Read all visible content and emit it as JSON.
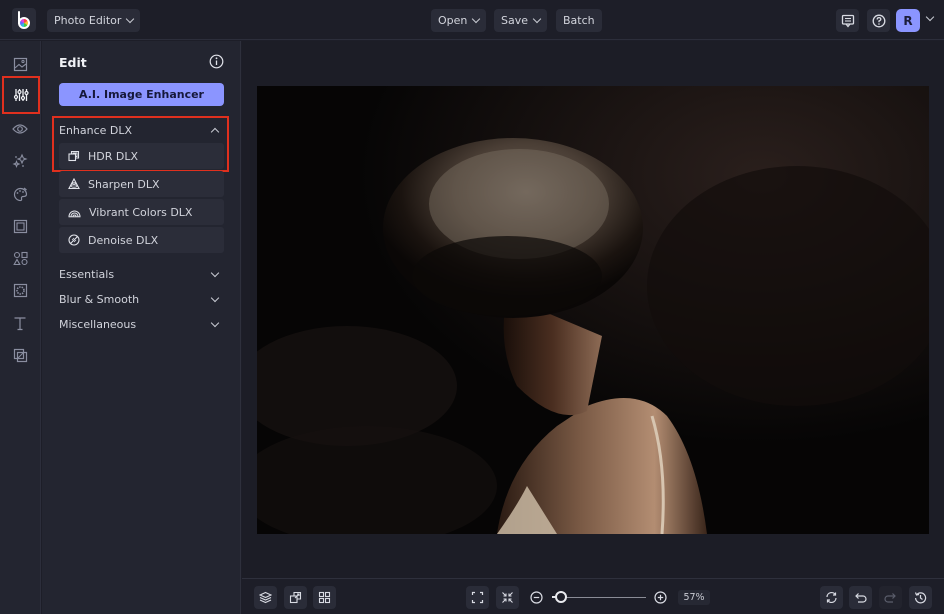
{
  "app": {
    "menu_label": "Photo Editor"
  },
  "toolbar": {
    "open_label": "Open",
    "save_label": "Save",
    "batch_label": "Batch",
    "avatar_initial": "R"
  },
  "rail": {
    "items": [
      {
        "icon": "image-icon",
        "active": false
      },
      {
        "icon": "sliders-icon",
        "active": true
      },
      {
        "icon": "eye-icon",
        "active": false
      },
      {
        "icon": "sparkles-icon",
        "active": false
      },
      {
        "icon": "palette-icon",
        "active": false
      },
      {
        "icon": "frame-icon",
        "active": false
      },
      {
        "icon": "shapes-icon",
        "active": false
      },
      {
        "icon": "texture-icon",
        "active": false
      },
      {
        "icon": "text-icon",
        "active": false
      },
      {
        "icon": "overlay-icon",
        "active": false
      }
    ]
  },
  "panel": {
    "title": "Edit",
    "ai_button": "A.I. Image Enhancer",
    "sections": [
      {
        "label": "Enhance DLX",
        "expanded": true,
        "items": [
          {
            "label": "HDR DLX",
            "icon": "hdr-icon"
          },
          {
            "label": "Sharpen DLX",
            "icon": "sharpen-icon"
          },
          {
            "label": "Vibrant Colors DLX",
            "icon": "vibrant-icon"
          },
          {
            "label": "Denoise DLX",
            "icon": "denoise-icon"
          }
        ]
      },
      {
        "label": "Essentials",
        "expanded": false
      },
      {
        "label": "Blur & Smooth",
        "expanded": false
      },
      {
        "label": "Miscellaneous",
        "expanded": false
      }
    ]
  },
  "canvas": {
    "image_description": "Portrait of a woman with an afro in dramatic side lighting against a dark background"
  },
  "bottombar": {
    "zoom_value": "57%",
    "zoom_fraction": 0.1
  },
  "colors": {
    "accent": "#8b95ff",
    "highlight_box": "#e0301e",
    "background": "#1d1e28",
    "panel": "#232530"
  }
}
